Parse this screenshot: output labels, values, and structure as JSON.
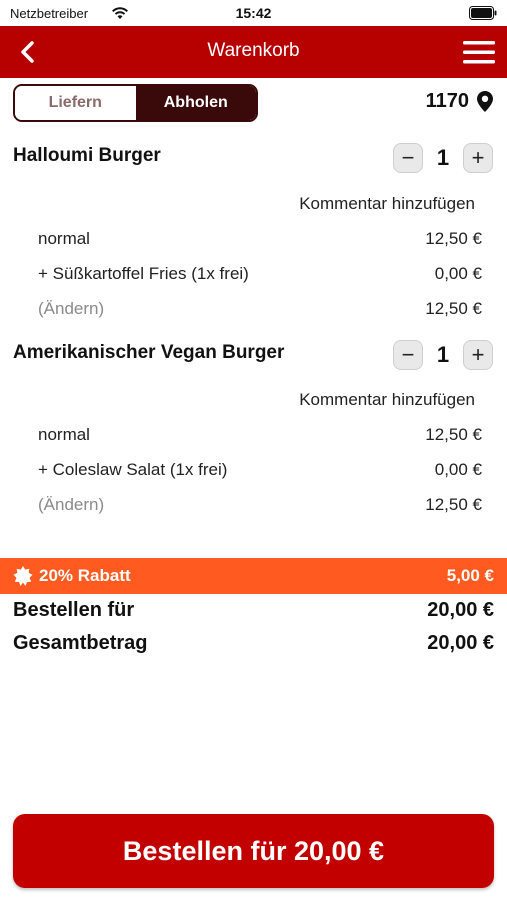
{
  "status_bar": {
    "carrier": "Netzbetreiber",
    "time": "15:42"
  },
  "header": {
    "title": "Warenkorb"
  },
  "mode_toggle": {
    "options": [
      "Liefern",
      "Abholen"
    ],
    "selected": "Abholen"
  },
  "postal_code": "1170",
  "items": [
    {
      "name": "Halloumi Burger",
      "quantity": "1",
      "comment_label": "Kommentar hinzufügen",
      "lines": [
        {
          "label": "normal",
          "price": "12,50 €"
        },
        {
          "label": "+ Süßkartoffel Fries (1x frei)",
          "price": "0,00 €"
        },
        {
          "label": "(Ändern)",
          "price": "12,50 €"
        }
      ]
    },
    {
      "name": "Amerikanischer Vegan Burger",
      "quantity": "1",
      "comment_label": "Kommentar hinzufügen",
      "lines": [
        {
          "label": "normal",
          "price": "12,50 €"
        },
        {
          "label": "+ Coleslaw Salat (1x frei)",
          "price": "0,00 €"
        },
        {
          "label": "(Ändern)",
          "price": "12,50 €"
        }
      ]
    }
  ],
  "discount": {
    "label": "20% Rabatt",
    "amount": "5,00 €"
  },
  "totals": {
    "order_for_label": "Bestellen für",
    "order_for_value": "20,00 €",
    "total_label": "Gesamtbetrag",
    "total_value": "20,00 €"
  },
  "order_button": {
    "label": "Bestellen für 20,00 €"
  },
  "colors": {
    "brand_red": "#b70000",
    "discount_orange": "#ff5a1f",
    "toggle_dark": "#3a0a0a"
  }
}
